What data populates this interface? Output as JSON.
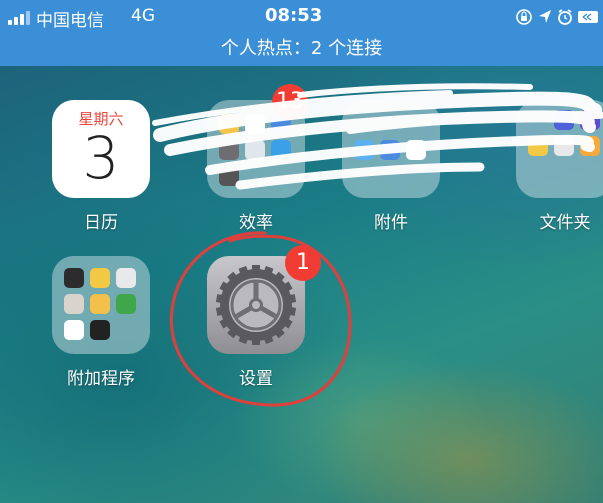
{
  "status_bar": {
    "carrier": "中国电信",
    "network": "4G",
    "time": "08:53",
    "icons": [
      "rotation-lock-icon",
      "location-arrow-icon",
      "alarm-icon",
      "battery-icon"
    ],
    "hotspot_banner": "个人热点：2 个连接",
    "background_color": "#3b8fd6"
  },
  "home": {
    "apps": [
      {
        "id": "calendar",
        "label": "日历",
        "weekday": "星期六",
        "day": "3"
      },
      {
        "id": "efficiency",
        "label": "效率",
        "badge": "13"
      },
      {
        "id": "accessories",
        "label": "附件"
      },
      {
        "id": "folder",
        "label": "文件夹"
      },
      {
        "id": "extras",
        "label": "附加程序"
      },
      {
        "id": "settings",
        "label": "设置",
        "badge": "1"
      }
    ]
  },
  "colors": {
    "badge": "#f03c32",
    "annotation_circle": "#e0403c",
    "calendar_weekday": "#e8453c"
  }
}
